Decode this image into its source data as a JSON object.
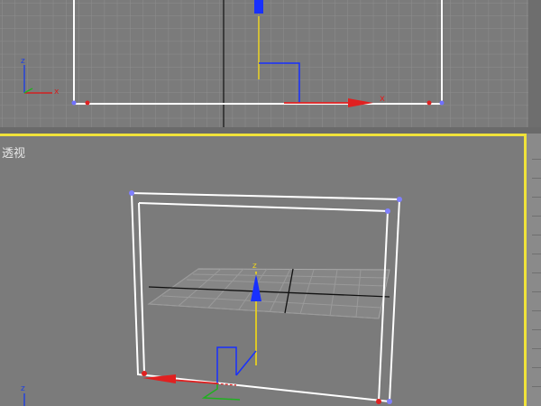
{
  "viewports": {
    "top": {
      "name": "top-viewport"
    },
    "perspective": {
      "label": "透视"
    }
  },
  "axes": {
    "x": "x",
    "y": "y",
    "z": "z"
  },
  "colors": {
    "active_border": "#f0e23a",
    "grid": "#8f8f8f",
    "axis_x": "#d22020",
    "axis_y": "#20b020",
    "axis_z": "#2040e0",
    "gizmo_yellow": "#e8d020"
  }
}
